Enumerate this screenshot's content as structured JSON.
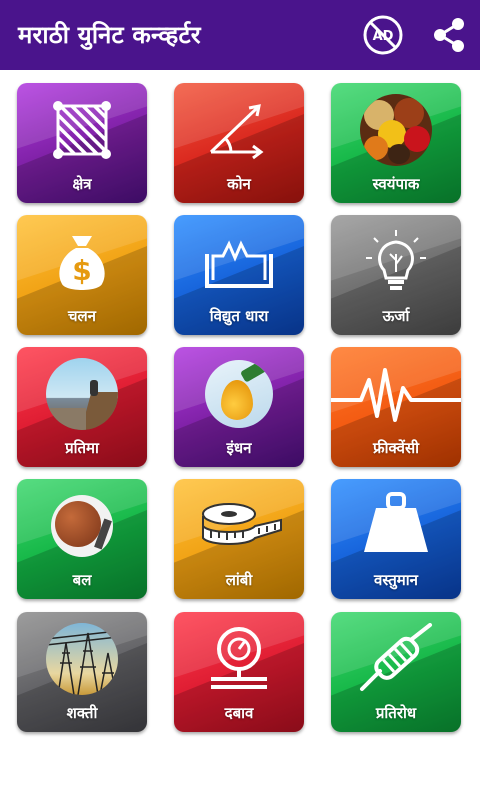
{
  "app_title": "मराठी युनिट कन्व्हर्टर",
  "header_icons": [
    "no-ads-icon",
    "share-icon"
  ],
  "colors": {
    "appbar": "#4a148c",
    "tile_text": "#ffffff"
  },
  "tiles": [
    {
      "label": "क्षेत्र",
      "icon": "area-icon",
      "color": "purple"
    },
    {
      "label": "कोन",
      "icon": "angle-icon",
      "color": "red"
    },
    {
      "label": "स्वयंपाक",
      "icon": "spices-photo-icon",
      "color": "green"
    },
    {
      "label": "चलन",
      "icon": "money-bag-icon",
      "color": "gold"
    },
    {
      "label": "विद्युत धारा",
      "icon": "electric-current-icon",
      "color": "blue"
    },
    {
      "label": "ऊर्जा",
      "icon": "light-bulb-icon",
      "color": "gray"
    },
    {
      "label": "प्रतिमा",
      "icon": "image-photo-icon",
      "color": "crimson"
    },
    {
      "label": "इंधन",
      "icon": "fuel-drop-icon",
      "color": "purple"
    },
    {
      "label": "फ्रीक्वेंसी",
      "icon": "frequency-wave-icon",
      "color": "orange"
    },
    {
      "label": "बल",
      "icon": "rock-push-photo-icon",
      "color": "green"
    },
    {
      "label": "लांबी",
      "icon": "measuring-tape-icon",
      "color": "gold"
    },
    {
      "label": "वस्तुमान",
      "icon": "weight-icon",
      "color": "blue"
    },
    {
      "label": "शक्ती",
      "icon": "power-tower-photo-icon",
      "color": "slate"
    },
    {
      "label": "दबाव",
      "icon": "pressure-gauge-icon",
      "color": "crimson"
    },
    {
      "label": "प्रतिरोध",
      "icon": "resistor-icon",
      "color": "green"
    }
  ]
}
